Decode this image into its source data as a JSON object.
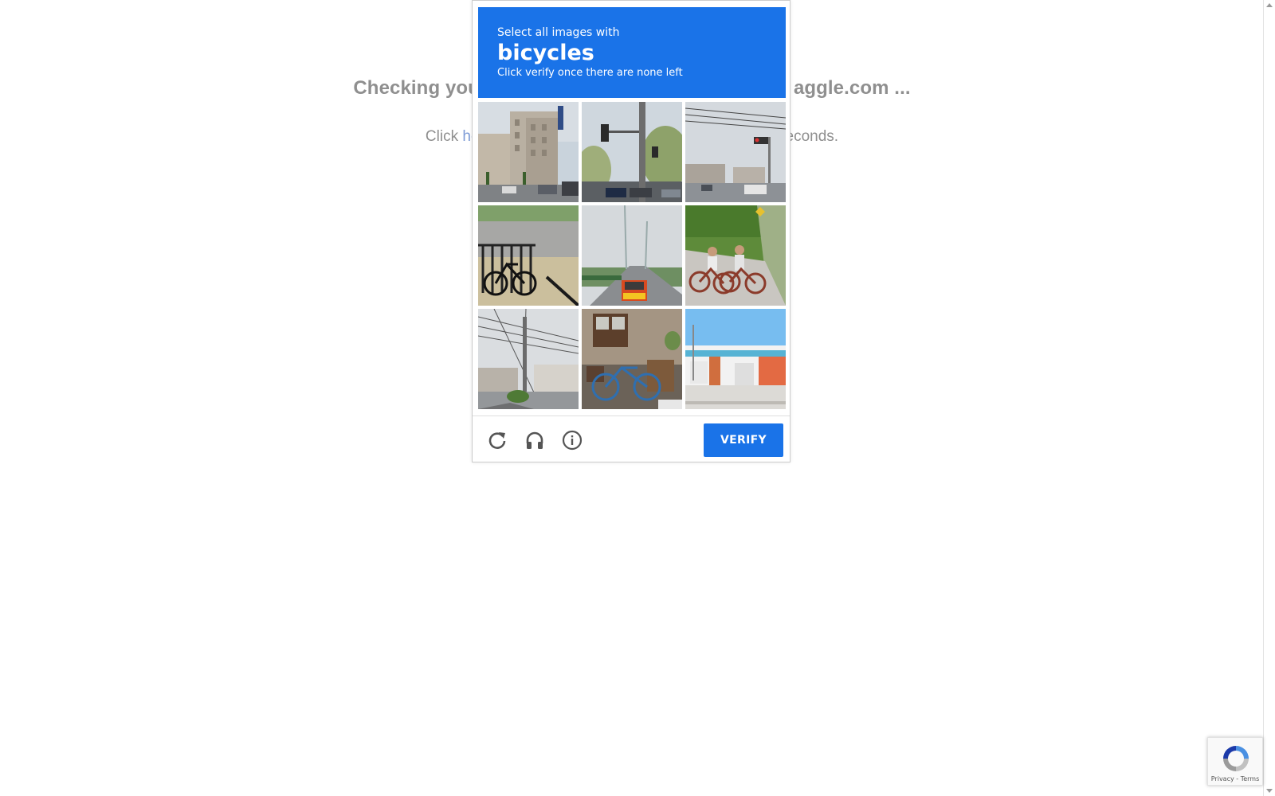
{
  "background": {
    "heading_left": "Checking you",
    "heading_right": "aggle.com ...",
    "sub_left": "Click ",
    "sub_link": "he",
    "sub_right": "econds."
  },
  "captcha": {
    "instruction": "Select all images with",
    "object": "bicycles",
    "hint": "Click verify once there are none left",
    "accent_color": "#1a73e8",
    "tiles": [
      {
        "name": "tile-building-street"
      },
      {
        "name": "tile-traffic-light-pole"
      },
      {
        "name": "tile-intersection-signal"
      },
      {
        "name": "tile-bicycle-fence"
      },
      {
        "name": "tile-bus-road"
      },
      {
        "name": "tile-children-bicycles"
      },
      {
        "name": "tile-power-lines"
      },
      {
        "name": "tile-bicycle-indoor"
      },
      {
        "name": "tile-blue-white-building"
      }
    ],
    "footer": {
      "reload_icon": "reload-icon",
      "audio_icon": "headphones-icon",
      "info_icon": "info-icon",
      "verify_label": "VERIFY"
    }
  },
  "badge": {
    "links": "Privacy - Terms"
  }
}
